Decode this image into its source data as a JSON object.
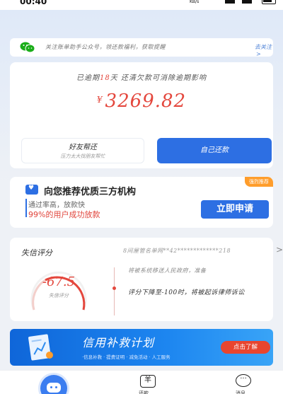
{
  "status_bar": {
    "time": "00:40",
    "net_speed": "KB/s",
    "battery": "95"
  },
  "notice": {
    "icon": "wechat-icon",
    "text": "关注账单助手公众号，领还款福利，获取提醒",
    "link": "去关注",
    "link_arrow": ">"
  },
  "overdue": {
    "prefix": "已逾期",
    "days": "18",
    "suffix": "天 还清欠款可消除逾期影响",
    "currency": "¥",
    "amount": "3269.82"
  },
  "actions": {
    "help_title": "好友帮还",
    "help_sub": "压力太大找朋友帮忙",
    "self_repay": "自己还款"
  },
  "recommend": {
    "badge": "强烈推荐",
    "title": "向您推荐优质三方机构",
    "line1": "通过率高，放款快",
    "line2": "99%的用户成功放款",
    "apply_button": "立即申请"
  },
  "credit": {
    "title": "失信评分",
    "record_no": "8间屋管名单网**42*************218",
    "arrow": ">",
    "score": "-67.5",
    "score_label": "失信评分",
    "timeline": [
      "将被系统移送人民政府，准备",
      "评分下降至-100时，将被起诉律师诉讼"
    ]
  },
  "banner": {
    "title": "信用补救计划",
    "subtitle": "·信息补救 · 提费证明 · 减免活动 · 人工服务",
    "button": "点击了解"
  },
  "tabs": {
    "repay_icon": "羊",
    "repay_label": "还款",
    "message_icon": "···",
    "message_label": "消息"
  },
  "colors": {
    "primary": "#2d6fe3",
    "danger": "#e4473d",
    "badge": "#ff9d2b"
  }
}
